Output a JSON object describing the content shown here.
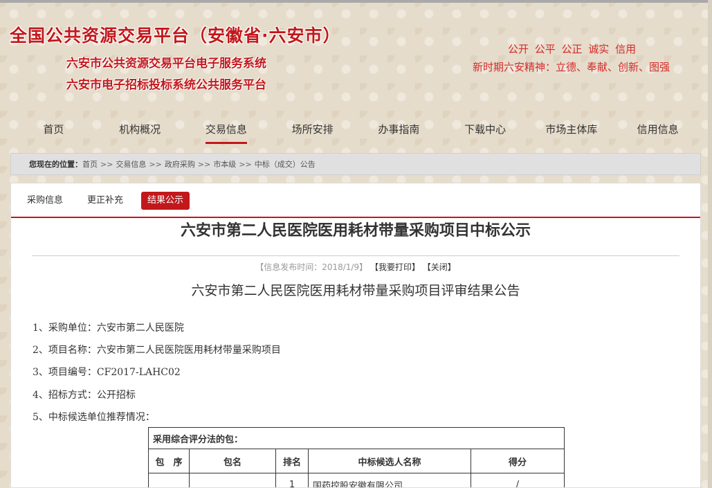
{
  "header": {
    "site_title": "全国公共资源交易平台（安徽省·六安市）",
    "subtitle_1": "六安市公共资源交易平台电子服务系统",
    "subtitle_2": "六安市电子招标投标系统公共服务平台",
    "slogan_1": "公开 公平 公正 诚实 信用",
    "slogan_2": "新时期六安精神：立德、奉献、创新、图强"
  },
  "nav": {
    "items": [
      "首页",
      "机构概况",
      "交易信息",
      "场所安排",
      "办事指南",
      "下载中心",
      "市场主体库",
      "信用信息"
    ],
    "active_index": 2
  },
  "breadcrumb": {
    "label": "您现在的位置：",
    "items": [
      "首页",
      "交易信息",
      "政府采购",
      "市本级",
      "中标（成交）公告"
    ],
    "separator": ">>"
  },
  "tabs": {
    "items": [
      "采购信息",
      "更正补充",
      "结果公示"
    ],
    "active_index": 2
  },
  "article": {
    "title": "六安市第二人民医院医用耗材带量采购项目中标公示",
    "publish_time": "【信息发布时间：2018/1/9】",
    "print_label": "【我要打印】",
    "close_label": "【关闭】",
    "subtitle": "六安市第二人民医院医用耗材带量采购项目评审结果公告",
    "items": [
      "1、采购单位：六安市第二人民医院",
      "2、项目名称：六安市第二人民医院医用耗材带量采购项目",
      "3、项目编号：CF2017-LAHC02",
      "4、招标方式：公开招标",
      "5、中标候选单位推荐情况："
    ]
  },
  "result_table": {
    "caption": "采用综合评分法的包：",
    "headers": [
      "包　序",
      "包名",
      "排名",
      "中标候选人名称",
      "得分"
    ],
    "rows": [
      {
        "package_no": "",
        "package_name": "",
        "rank": "1",
        "name": "国药控股安徽有限公司",
        "score": "/"
      }
    ]
  },
  "colors": {
    "brand_red": "#c2181c",
    "slogan_red": "#d42b2b",
    "background": "#e6dccb"
  }
}
